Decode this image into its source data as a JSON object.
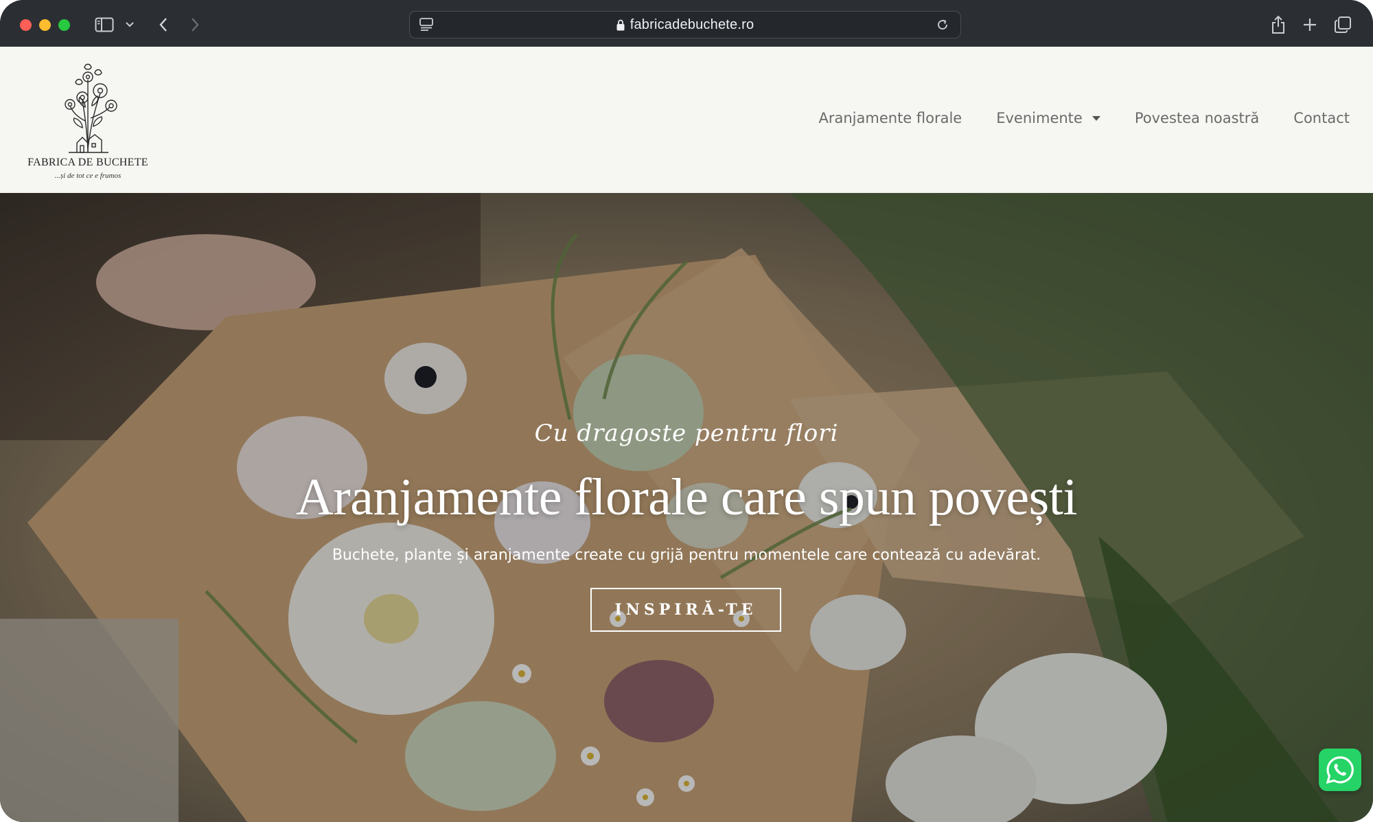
{
  "browser": {
    "url": "fabricadebuchete.ro",
    "icons": {
      "sidebar": "sidebar-toggle-icon",
      "back": "chevron-left-icon",
      "forward": "chevron-right-icon",
      "reader": "reader-icon",
      "lock": "lock-icon",
      "reload": "reload-icon",
      "share": "share-icon",
      "new_tab": "plus-icon",
      "tabs": "tabs-overview-icon"
    }
  },
  "header": {
    "logo_name": "FABRICA DE BUCHETE",
    "logo_tagline": "...și de tot ce e frumos",
    "nav": [
      {
        "label": "Aranjamente florale"
      },
      {
        "label": "Evenimente"
      },
      {
        "label": "Povestea noastră"
      },
      {
        "label": "Contact"
      }
    ]
  },
  "hero": {
    "eyebrow": "Cu dragoste pentru flori",
    "title": "Aranjamente florale care spun povești",
    "subtitle": "Buchete, plante și aranjamente create cu grijă pentru momentele care contează cu adevărat.",
    "cta": "INSPIRĂ-TE"
  },
  "floating": {
    "whatsapp_icon": "whatsapp-icon"
  },
  "colors": {
    "chrome_bg": "#2b2f33",
    "header_bg": "#f6f6f3",
    "nav_text": "#6a6a6a",
    "whatsapp": "#25d366"
  }
}
